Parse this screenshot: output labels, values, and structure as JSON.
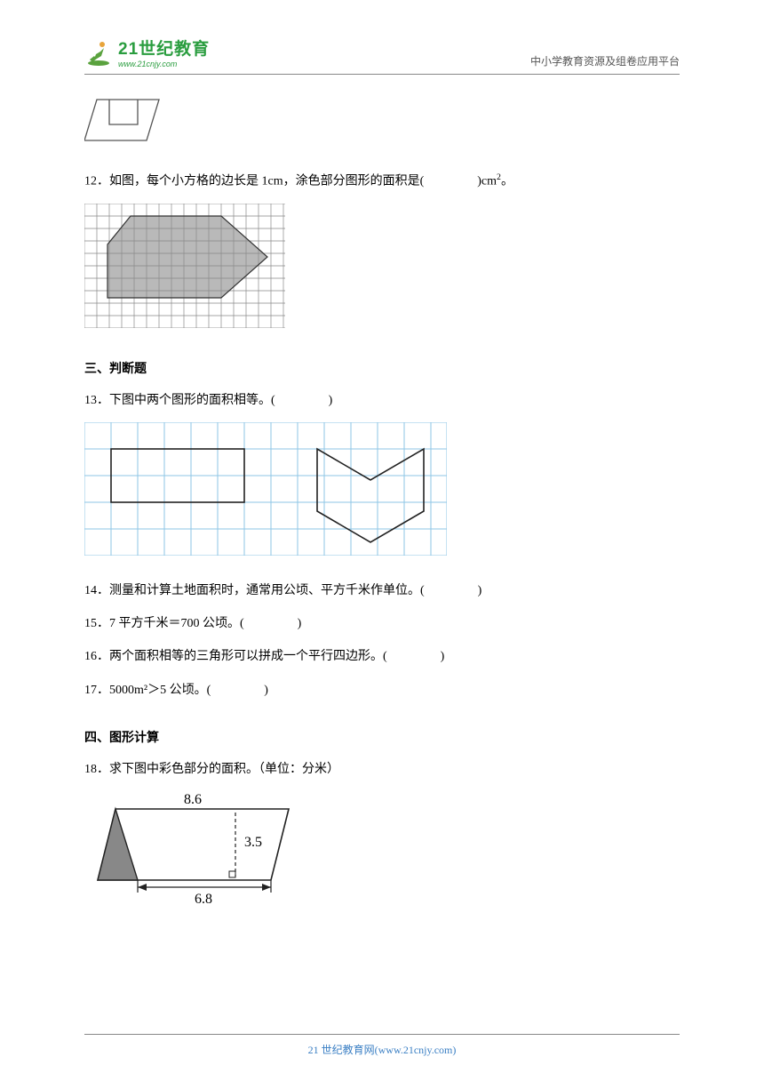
{
  "header": {
    "logo_main": "21世纪教育",
    "logo_url": "www.21cnjy.com",
    "right": "中小学教育资源及组卷应用平台"
  },
  "questions": {
    "q12": {
      "num": "12．",
      "text_a": "如图，每个小方格的边长是 1cm，涂色部分图形的面积是(",
      "text_b": ")cm",
      "sup": "2",
      "text_c": "。"
    },
    "sec3_title": "三、判断题",
    "q13": {
      "num": "13．",
      "text_a": "下图中两个图形的面积相等。(",
      "text_b": ")"
    },
    "q14": {
      "num": "14．",
      "text_a": "测量和计算土地面积时，通常用公顷、平方千米作单位。(",
      "text_b": ")"
    },
    "q15": {
      "num": "15．",
      "text_a": "7 平方千米＝700 公顷。(",
      "text_b": ")"
    },
    "q16": {
      "num": "16．",
      "text_a": "两个面积相等的三角形可以拼成一个平行四边形。(",
      "text_b": ")"
    },
    "q17": {
      "num": "17．",
      "text_a": "5000m²＞5 公顷。(",
      "text_b": ")"
    },
    "sec4_title": "四、图形计算",
    "q18": {
      "num": "18．",
      "text": "求下图中彩色部分的面积。（单位：分米）"
    },
    "q18_fig": {
      "top": "8.6",
      "height": "3.5",
      "bottom": "6.8"
    }
  },
  "footer": {
    "text_a": "21 世纪教育网(www.21cnjy.com)"
  }
}
